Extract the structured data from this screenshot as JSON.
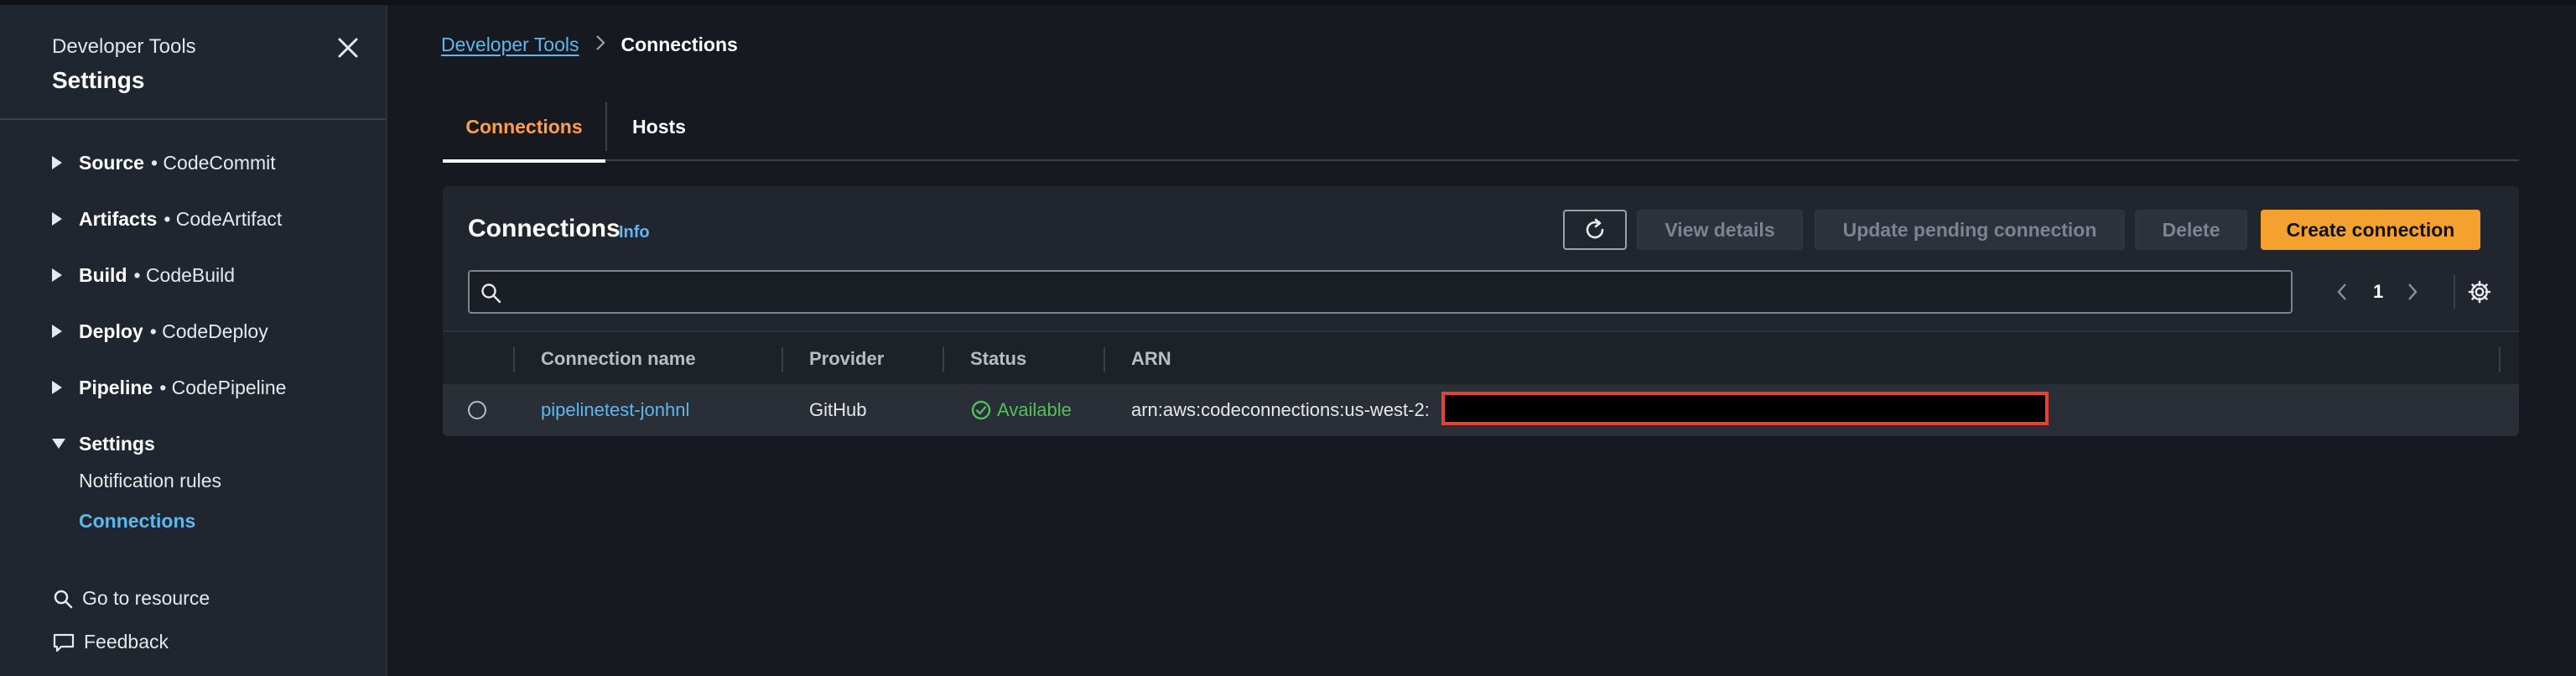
{
  "sidebar": {
    "subtitle": "Developer Tools",
    "title": "Settings",
    "sections": [
      {
        "bold": "Source",
        "rest": "• CodeCommit"
      },
      {
        "bold": "Artifacts",
        "rest": "• CodeArtifact"
      },
      {
        "bold": "Build",
        "rest": "• CodeBuild"
      },
      {
        "bold": "Deploy",
        "rest": "• CodeDeploy"
      },
      {
        "bold": "Pipeline",
        "rest": "• CodePipeline"
      },
      {
        "bold": "Settings",
        "rest": ""
      }
    ],
    "settings_items": [
      "Notification rules",
      "Connections"
    ],
    "go_to_resource": "Go to resource",
    "feedback": "Feedback"
  },
  "breadcrumb": {
    "root": "Developer Tools",
    "current": "Connections"
  },
  "tabs": [
    "Connections",
    "Hosts"
  ],
  "panel": {
    "title": "Connections",
    "info": "Info",
    "buttons": {
      "view_details": "View details",
      "update_pending": "Update pending connection",
      "delete": "Delete",
      "create": "Create connection"
    },
    "search_placeholder": "",
    "page": "1"
  },
  "table": {
    "columns": [
      "Connection name",
      "Provider",
      "Status",
      "ARN"
    ],
    "rows": [
      {
        "name": "pipelinetest-jonhnl",
        "provider": "GitHub",
        "status": "Available",
        "arn": "arn:aws:codeconnections:us-west-2:"
      }
    ]
  },
  "colors": {
    "accent_orange": "#ff9e4a",
    "primary_button": "#f5a130",
    "link_blue": "#5fb7ee",
    "status_green": "#4fc05c",
    "redaction_border": "#e8412f"
  }
}
